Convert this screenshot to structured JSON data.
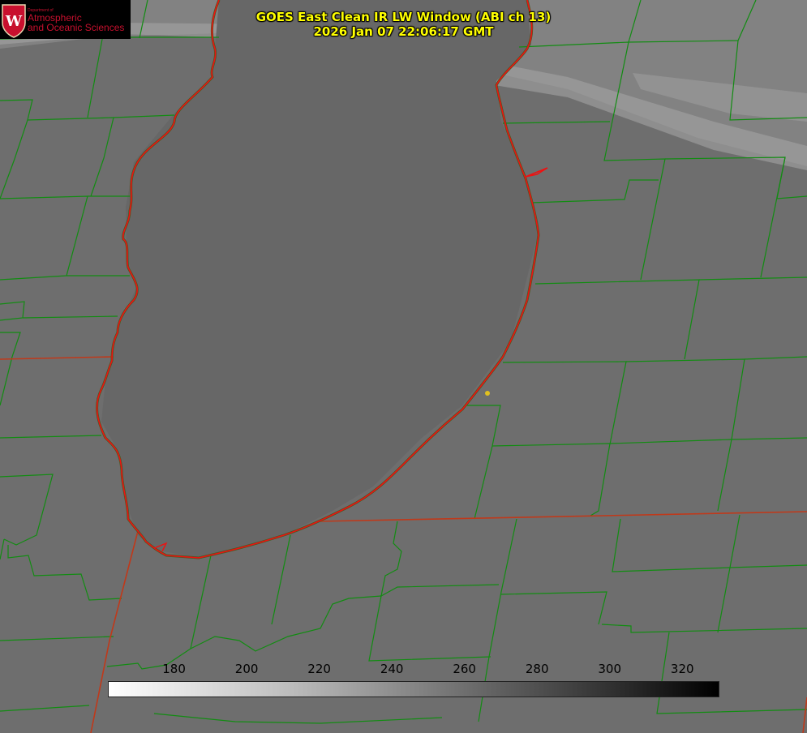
{
  "title": {
    "line1": "GOES East Clean IR LW Window (ABI ch 13)",
    "line2": "2026 Jan 07 22:06:17 GMT"
  },
  "logo": {
    "department": "Department of",
    "line1": "Atmospheric",
    "line2": "and Oceanic Sciences",
    "mark_letter": "W"
  },
  "colorbar": {
    "min": 162,
    "max": 330,
    "ticks": [
      "180",
      "200",
      "220",
      "240",
      "260",
      "280",
      "300",
      "320"
    ]
  },
  "colors": {
    "background": "#6e6e6e",
    "county_lines": "#128c12",
    "state_lines": "#c0391a",
    "coastline": "#ee1111",
    "marker": "#e0c020",
    "title_text": "#ffff00",
    "logo_red": "#c8102e"
  }
}
